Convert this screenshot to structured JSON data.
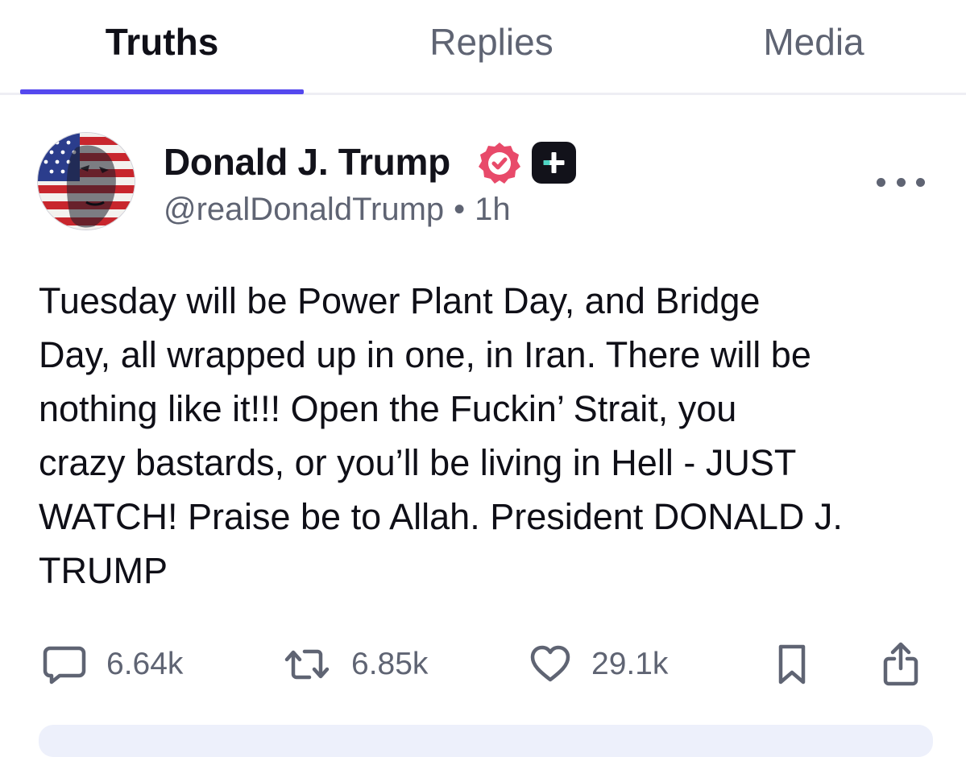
{
  "tabs": [
    {
      "label": "Truths",
      "active": true
    },
    {
      "label": "Replies",
      "active": false
    },
    {
      "label": "Media",
      "active": false
    }
  ],
  "post": {
    "author": {
      "display_name": "Donald J. Trump",
      "handle": "@realDonaldTrump",
      "verified": true
    },
    "separator": "•",
    "time": "1h",
    "text": "Tuesday will be Power Plant Day, and Bridge\nDay, all wrapped up in one, in Iran. There will be\nnothing like it!!! Open the Fuckin’ Strait, you\ncrazy bastards, or you’ll be living in Hell - JUST\nWATCH! Praise be to Allah. President DONALD J.\nTRUMP",
    "stats": {
      "replies": "6.64k",
      "retruths": "6.85k",
      "likes": "29.1k"
    }
  },
  "icons": {
    "verified": "verified-badge-icon",
    "plus": "plus-badge-icon",
    "more": "more-icon",
    "reply": "comment-icon",
    "retruth": "retruth-icon",
    "like": "heart-icon",
    "bookmark": "bookmark-icon",
    "share": "share-icon"
  },
  "colors": {
    "accent": "#5448ee",
    "verified": "#e84a6a",
    "plus_badge_cross": "#4fd6c4",
    "muted_text": "#5f6473"
  }
}
